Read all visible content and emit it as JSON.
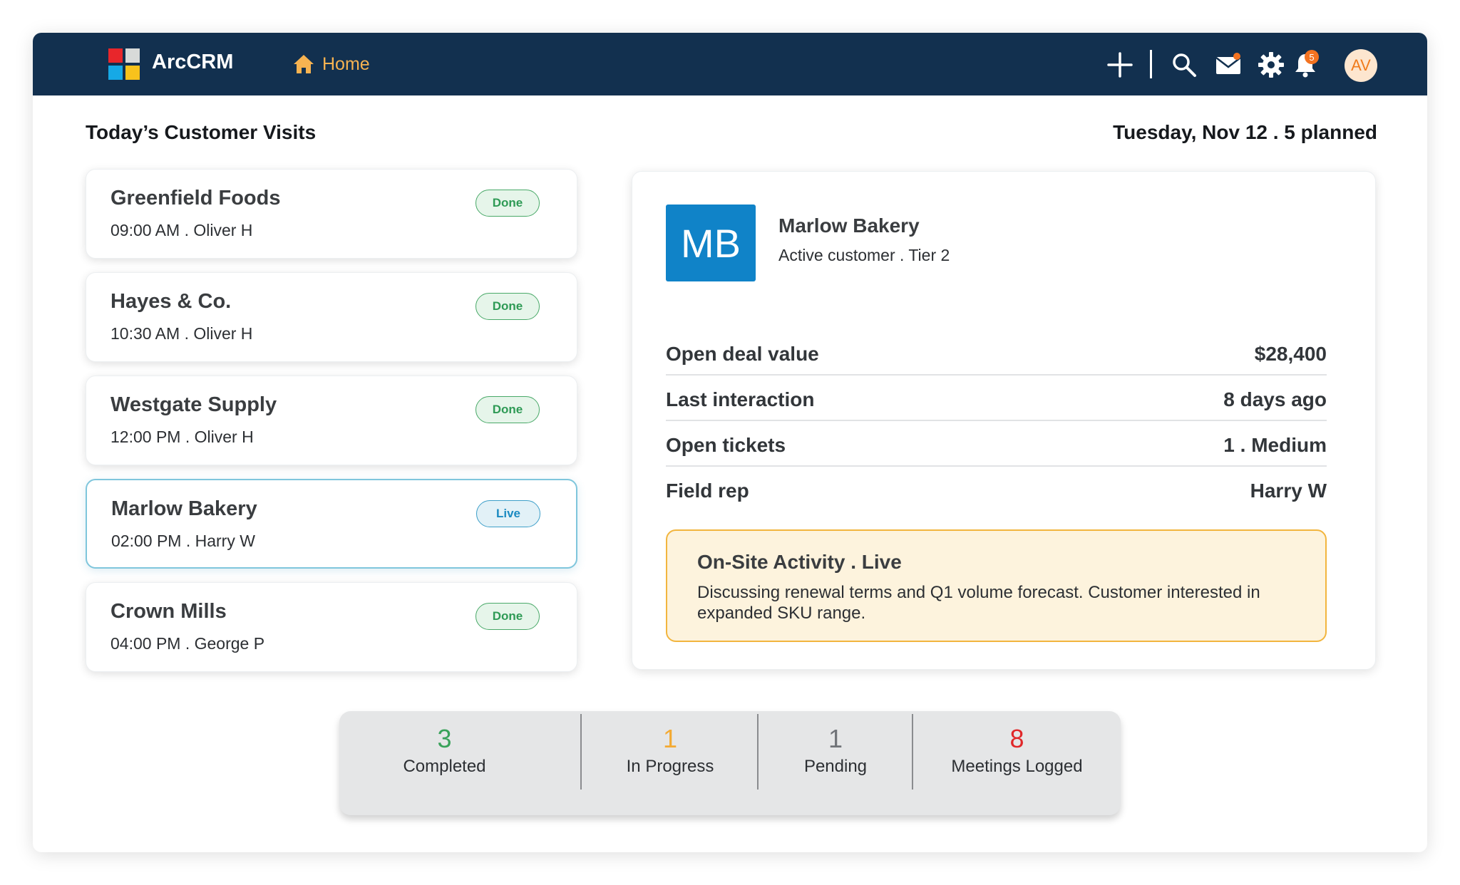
{
  "colors": {
    "topbar": "#12304f",
    "home_accent": "#f7b351",
    "done": "#2e9a55",
    "live": "#1b8ac1",
    "completed_count": "#39a25a",
    "in_progress_count": "#f3aa33",
    "pending_count": "#707378",
    "meetings_count": "#e0282a",
    "monogram_bg": "#1083c8"
  },
  "topbar": {
    "brand": "ArcCRM",
    "home_label": "Home",
    "icons": [
      "plus-icon",
      "search-icon",
      "mail-icon",
      "gear-icon",
      "bell-icon"
    ],
    "notification_count": "5",
    "avatar_initials": "AV"
  },
  "header": {
    "title": "Today’s Customer Visits",
    "date_summary": "Tuesday, Nov 12 . 5 planned"
  },
  "visits": [
    {
      "name": "Greenfield Foods",
      "meta": "09:00 AM  . Oliver H",
      "status": "Done"
    },
    {
      "name": "Hayes & Co.",
      "meta": "10:30 AM  . Oliver H",
      "status": "Done"
    },
    {
      "name": "Westgate Supply",
      "meta": "12:00 PM  . Oliver H",
      "status": "Done"
    },
    {
      "name": "Marlow Bakery",
      "meta": "02:00 PM  .  Harry W",
      "status": "Live"
    },
    {
      "name": "Crown Mills",
      "meta": "04:00 PM  . George P",
      "status": "Done"
    }
  ],
  "detail": {
    "monogram": "MB",
    "name": "Marlow Bakery",
    "subtitle": "Active customer . Tier 2",
    "stats": [
      {
        "label": "Open deal value",
        "value": "$28,400"
      },
      {
        "label": "Last interaction",
        "value": "8 days ago"
      },
      {
        "label": "Open tickets",
        "value": "1 . Medium"
      },
      {
        "label": "Field rep",
        "value": "Harry W"
      }
    ],
    "activity": {
      "title": "On-Site Activity . Live",
      "body": "Discussing renewal terms and Q1 volume forecast. Customer interested in expanded SKU range."
    }
  },
  "summary": [
    {
      "value": "3",
      "label": "Completed"
    },
    {
      "value": "1",
      "label": "In Progress"
    },
    {
      "value": "1",
      "label": "Pending"
    },
    {
      "value": "8",
      "label": "Meetings Logged"
    }
  ]
}
